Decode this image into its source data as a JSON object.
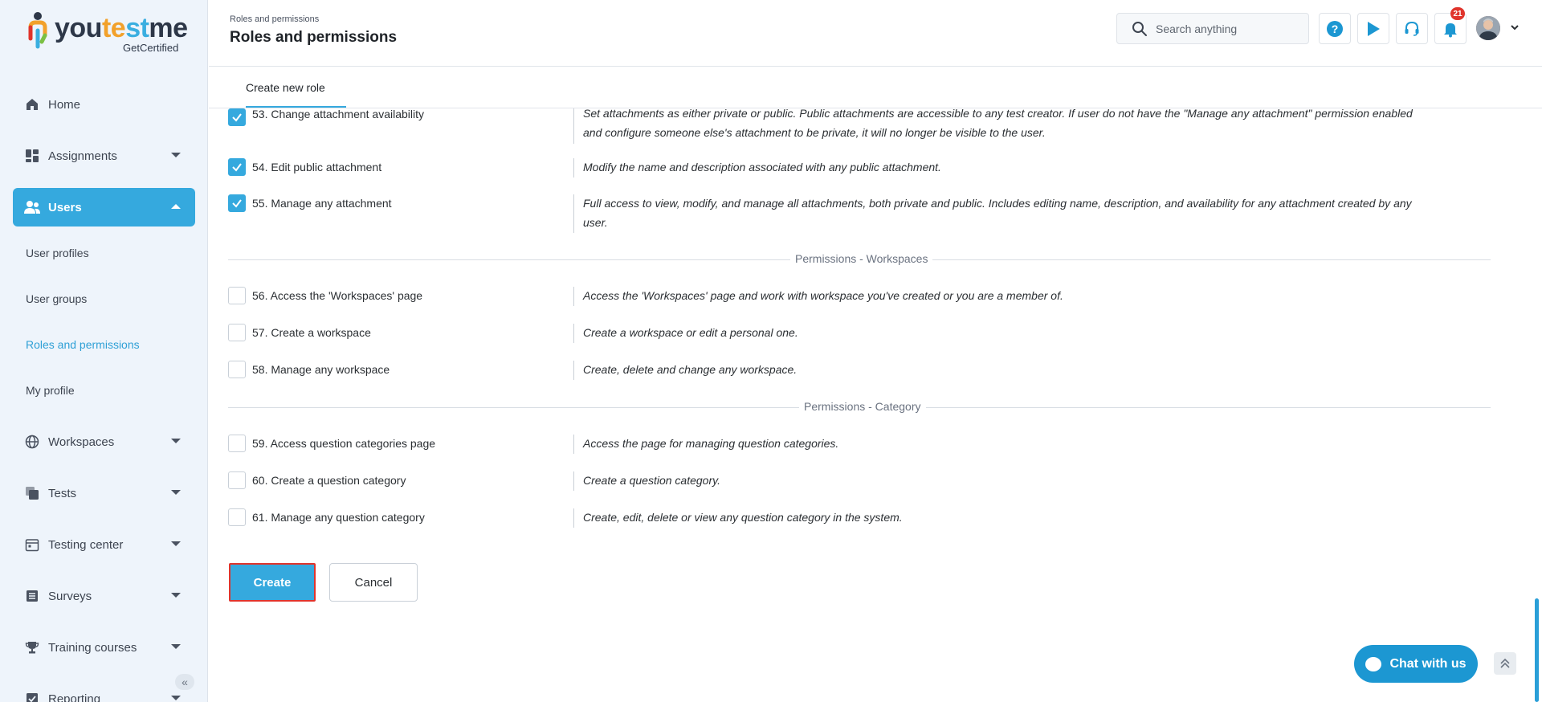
{
  "brand": {
    "name_part1": "you",
    "name_part2": "te",
    "name_part3": "st",
    "name_part4": "me",
    "sub": "GetCertified"
  },
  "sidebar": {
    "items": [
      {
        "label": "Home",
        "icon": "home-icon"
      },
      {
        "label": "Assignments",
        "icon": "assignments-icon"
      },
      {
        "label": "Users",
        "icon": "users-icon"
      },
      {
        "label": "Workspaces",
        "icon": "globe-icon"
      },
      {
        "label": "Tests",
        "icon": "tests-icon"
      },
      {
        "label": "Testing center",
        "icon": "calendar-icon"
      },
      {
        "label": "Surveys",
        "icon": "surveys-icon"
      },
      {
        "label": "Training courses",
        "icon": "trophy-icon"
      },
      {
        "label": "Reporting",
        "icon": "reporting-icon"
      }
    ],
    "users_sub": [
      "User profiles",
      "User groups",
      "Roles and permissions",
      "My profile"
    ]
  },
  "header": {
    "breadcrumb": "Roles and permissions",
    "title": "Roles and permissions",
    "search_placeholder": "Search anything",
    "notifications_count": "21"
  },
  "tabs": {
    "active": "Create new role"
  },
  "permissions": [
    {
      "label": "53. Change attachment availability",
      "checked": true,
      "desc": "Set attachments as either private or public. Public attachments are accessible to any test creator. If user do not have the \"Manage any attachment\" permission enabled and configure someone else's attachment to be private, it will no longer be visible to the user."
    },
    {
      "label": "54. Edit public attachment",
      "checked": true,
      "desc": "Modify the name and description associated with any public attachment."
    },
    {
      "label": "55. Manage any attachment",
      "checked": true,
      "desc": "Full access to view, modify, and manage all attachments, both private and public. Includes editing name, description, and availability for any attachment created by any user."
    },
    {
      "label": "56. Access the 'Workspaces' page",
      "checked": false,
      "desc": "Access the 'Workspaces' page and work with workspace you've created or you are a member of."
    },
    {
      "label": "57. Create a workspace",
      "checked": false,
      "desc": "Create a workspace or edit a personal one."
    },
    {
      "label": "58. Manage any workspace",
      "checked": false,
      "desc": "Create, delete and change any workspace."
    },
    {
      "label": "59. Access question categories page",
      "checked": false,
      "desc": "Access the page for managing question categories."
    },
    {
      "label": "60. Create a question category",
      "checked": false,
      "desc": "Create a question category."
    },
    {
      "label": "61. Manage any question category",
      "checked": false,
      "desc": "Create, edit, delete or view any question category in the system."
    }
  ],
  "sections": {
    "workspaces": "Permissions - Workspaces",
    "category": "Permissions - Category"
  },
  "actions": {
    "create": "Create",
    "cancel": "Cancel"
  },
  "chat": {
    "label": "Chat with us"
  },
  "colors": {
    "accent": "#35a9de",
    "sidebar_bg": "#eef4fb",
    "badge": "#e0342c"
  }
}
